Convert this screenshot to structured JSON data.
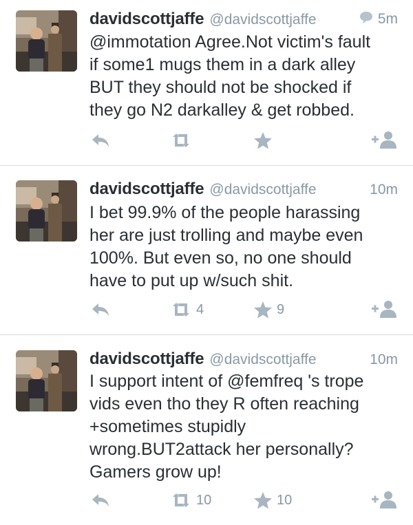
{
  "tweets": [
    {
      "name": "davidscottjaffe",
      "handle": "@davidscottjaffe",
      "time": "5m",
      "show_reply_indicator": true,
      "lines": [
        "@immotation Agree.Not victim's fault",
        "if some1 mugs them in a dark alley",
        "BUT they should not be shocked if",
        "they go N2 darkalley & get robbed."
      ],
      "retweets": "",
      "favorites": ""
    },
    {
      "name": "davidscottjaffe",
      "handle": "@davidscottjaffe",
      "time": "10m",
      "show_reply_indicator": false,
      "lines": [
        "I bet 99.9% of the people harassing",
        "her are just trolling and maybe even",
        "100%. But even so, no one should",
        "have to put up w/such shit."
      ],
      "retweets": "4",
      "favorites": "9"
    },
    {
      "name": "davidscottjaffe",
      "handle": "@davidscottjaffe",
      "time": "10m",
      "show_reply_indicator": false,
      "lines": [
        "I support intent of @femfreq 's trope",
        "vids even tho they R often reaching",
        "+sometimes stupidly",
        "wrong.BUT2attack her personally?",
        "Gamers grow up!"
      ],
      "retweets": "10",
      "favorites": "10"
    }
  ],
  "icons": {
    "reply": "reply-arrow-icon",
    "retweet": "retweet-icon",
    "favorite": "star-icon",
    "follow": "add-user-icon",
    "conversation": "speech-bubble-icon"
  },
  "colors": {
    "name": "#292f33",
    "meta": "#8899a6",
    "action_icon": "#a8b6c1",
    "divider": "#dbdbdb"
  }
}
